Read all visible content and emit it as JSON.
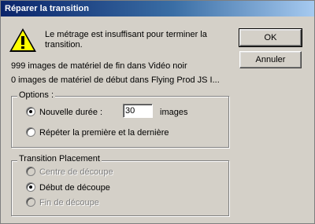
{
  "dialog": {
    "title": "Réparer la transition",
    "message": "Le métrage est insuffisant pour terminer la transition.",
    "info_line_1": "999 images de matériel de fin dans Vidéo noir",
    "info_line_2": "0 images de matériel de début dans Flying Prod JS I...",
    "icon": "warning-icon"
  },
  "buttons": {
    "ok_label": "OK",
    "cancel_label": "Annuler"
  },
  "options_group": {
    "legend": "Options :",
    "new_duration_label": "Nouvelle durée :",
    "new_duration_value": "30",
    "unit_label": "images",
    "repeat_label": "Répéter la première et la dernière",
    "selected": "new_duration"
  },
  "placement_group": {
    "legend": "Transition Placement",
    "centre_label": "Centre de découpe",
    "start_label": "Début de découpe",
    "end_label": "Fin de découpe",
    "selected": "start"
  }
}
